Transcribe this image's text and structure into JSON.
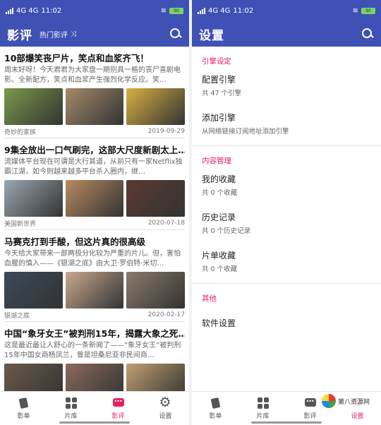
{
  "status": {
    "network": "4G 4G",
    "time": "11:02",
    "battery": "90"
  },
  "left": {
    "title": "影评",
    "subtitle": "热门影评",
    "shuffle_icon": "⤨",
    "articles": [
      {
        "title": "10部爆笑丧尸片，笑点和血浆齐飞！",
        "desc": "周末好呀！今天君君为大家盘一期别具一格的丧尸喜剧电影。全新配方，笑点和血浆产生强烈化学反应。笑…",
        "source": "奇妙的家族",
        "date": "2019-09-29",
        "thumbs": [
          "#7a9a4a",
          "#a58a6a",
          "#d8b040"
        ]
      },
      {
        "title": "9集全放出一口气刷完，这部大尺度新剧太上…",
        "desc": "流媒体平台现在可谓是大行其道，从前只有一家Netflix独霸江湖，如今则越来越多平台杀入圈内，继…",
        "source": "美国新世界",
        "date": "2020-07-18",
        "thumbs": [
          "#9aa8b0",
          "#b88a60",
          "#5a3a30"
        ]
      },
      {
        "title": "马赛克打到手酸，但这片真的很高级",
        "desc": "今天给大家带来一部两极分化较为严重的片儿。但，害怕血腥的慎入——《银湖之底》由大卫·罗伯特·米切…",
        "source": "银湖之底",
        "date": "2020-02-17",
        "thumbs": [
          "#3a4a5a",
          "#c8a890",
          "#8a7a6a"
        ]
      },
      {
        "title": "中国“象牙女王”被判刑15年，揭露大象之死…",
        "desc": "这是最近最让人舒心的一条新闻了——“象牙女王”被判刑15年中国女商杨凤兰，曾是坦桑尼亚非民间商…",
        "source": "",
        "date": "",
        "thumbs": [
          "#6a5a4a",
          "#8a6a5a",
          "#c0a070"
        ]
      }
    ],
    "nav": [
      {
        "label": "影单"
      },
      {
        "label": "片库"
      },
      {
        "label": "影评"
      },
      {
        "label": "设置"
      }
    ]
  },
  "right": {
    "title": "设置",
    "sections": [
      {
        "header": "引擎设定",
        "items": [
          {
            "title": "配置引擎",
            "sub": "共 47 个引擎"
          },
          {
            "title": "添加引擎",
            "sub": "从网络链接订阅地址添加引擎"
          }
        ]
      },
      {
        "header": "内容管理",
        "items": [
          {
            "title": "我的收藏",
            "sub": "共 0 个收藏"
          },
          {
            "title": "历史记录",
            "sub": "共 0 个历史记录"
          },
          {
            "title": "片单收藏",
            "sub": "共 0 个收藏"
          }
        ]
      },
      {
        "header": "其他",
        "items": [
          {
            "title": "软件设置",
            "sub": ""
          }
        ]
      }
    ],
    "nav": [
      {
        "label": "影单"
      },
      {
        "label": "片库"
      },
      {
        "label": "影评"
      },
      {
        "label": "设置"
      }
    ]
  },
  "watermark": "第八资源网",
  "colors": {
    "primary": "#3f51b5",
    "accent": "#e91e63"
  }
}
